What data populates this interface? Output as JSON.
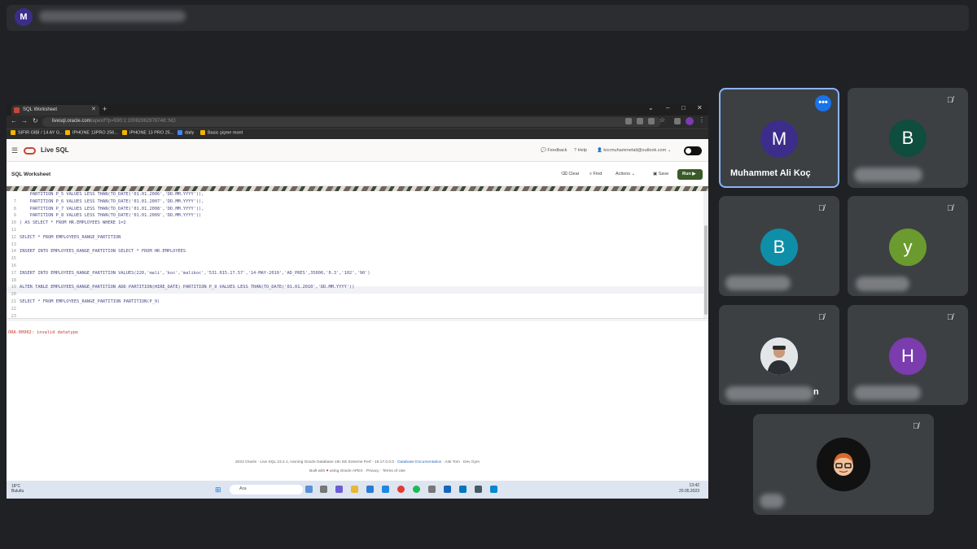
{
  "meet": {
    "presenter_initial": "M"
  },
  "browser": {
    "tab_title": "SQL Worksheet",
    "url_host": "livesql.oracle.com",
    "url_path": "/apex/f?p=590:1:10082962978748::NO",
    "bookmarks": [
      "SIFIR GİBİ / 14 AY G...",
      "IPHONE 13PRO 256...",
      "IPHONE 13 PRO 25...",
      "daily",
      "Basic şişme mont"
    ]
  },
  "app": {
    "name": "Live SQL",
    "feedback": "Feedback",
    "help": "Help",
    "user_email": "kocmuhammetali@outlook.com",
    "worksheet_title": "SQL Worksheet",
    "clear": "Clear",
    "find": "Find",
    "actions": "Actions",
    "save": "Save",
    "run": "Run"
  },
  "editor": {
    "lines": [
      {
        "n": "",
        "code": "    PARTITION P_5 VALUES LESS THAN(TO_DATE('01.01.2006','DD.MM.YYYY')),"
      },
      {
        "n": "7",
        "code": "    PARTITION P_6 VALUES LESS THAN(TO_DATE('01.01.2007','DD.MM.YYYY')),"
      },
      {
        "n": "8",
        "code": "    PARTITION P_7 VALUES LESS THAN(TO_DATE('01.01.2008','DD.MM.YYYY')),"
      },
      {
        "n": "9",
        "code": "    PARTITION P_8 VALUES LESS THAN(TO_DATE('01.01.2009','DD.MM.YYYY'))"
      },
      {
        "n": "10",
        "code": ") AS SELECT * FROM HR.EMPLOYEES WHERE 1=2"
      },
      {
        "n": "11",
        "code": ""
      },
      {
        "n": "12",
        "code": "SELECT * FROM EMPLOYEES_RANGE_PARTITION"
      },
      {
        "n": "13",
        "code": ""
      },
      {
        "n": "14",
        "code": "INSERT INTO EMPLOYEES_RANGE_PARTITION SELECT * FROM HR.EMPLOYEES"
      },
      {
        "n": "15",
        "code": ""
      },
      {
        "n": "16",
        "code": ""
      },
      {
        "n": "17",
        "code": "INSERT INTO EMPLOYEES_RANGE_PARTITION VALUES(220,'mali','koc','malikoc','531.015.17.57','14-MAY-2010','AD_PRES',35000,'0.3','102','90')"
      },
      {
        "n": "18",
        "code": ""
      },
      {
        "n": "19",
        "code": "ALTER TABLE EMPLOYEES_RANGE_PARTITION ADD PARTITION(HIRE_DATE) PARTITION P_9 VALUES LESS THAN(TO_DATE('01.01.2010','DD.MM.YYYY'))"
      },
      {
        "n": "20",
        "code": ""
      },
      {
        "n": "21",
        "code": "SELECT * FROM EMPLOYEES_RANGE_PARTITION PARTITION(P_9)"
      },
      {
        "n": "22",
        "code": ""
      },
      {
        "n": "23",
        "code": ""
      }
    ],
    "error": "ORA-00902: invalid datatype"
  },
  "footer": {
    "line1": "2023 Oracle · Live SQL 23.2.1, running Oracle Database 19c EE Extreme Perf - 19.17.0.0.0 ·",
    "doc_link": "Database Documentation",
    "asktom": "· Ask Tom · Dev Gym",
    "built_pre": "Built with",
    "heart": "♥",
    "built_post": "using Oracle APEX · Privacy · Terms of Use"
  },
  "taskbar": {
    "temp": "18°C",
    "weather": "Bulutlu",
    "search": "Ara",
    "time": "13:42",
    "date": "20.05.2023"
  },
  "participants": [
    {
      "initial": "M",
      "name": "Muhammet Ali Koç",
      "color": "#3c2d8a",
      "active": true
    },
    {
      "initial": "B",
      "name": "",
      "color": "#0f4d3e"
    },
    {
      "initial": "B",
      "name": "",
      "color": "#0f8ea8"
    },
    {
      "initial": "y",
      "name": "",
      "color": "#6b9b2e"
    },
    {
      "initial": "",
      "name_suffix": "n",
      "photo": "person"
    },
    {
      "initial": "H",
      "name": "",
      "color": "#7b3cae"
    },
    {
      "initial": "",
      "photo": "memoji"
    }
  ],
  "colors": {
    "meet_bg": "#202124",
    "tile_bg": "#3c4043",
    "active_border": "#8ab4f8",
    "oracle_red": "#c74634",
    "run_green": "#3a5a28",
    "error_red": "#c0392b"
  }
}
